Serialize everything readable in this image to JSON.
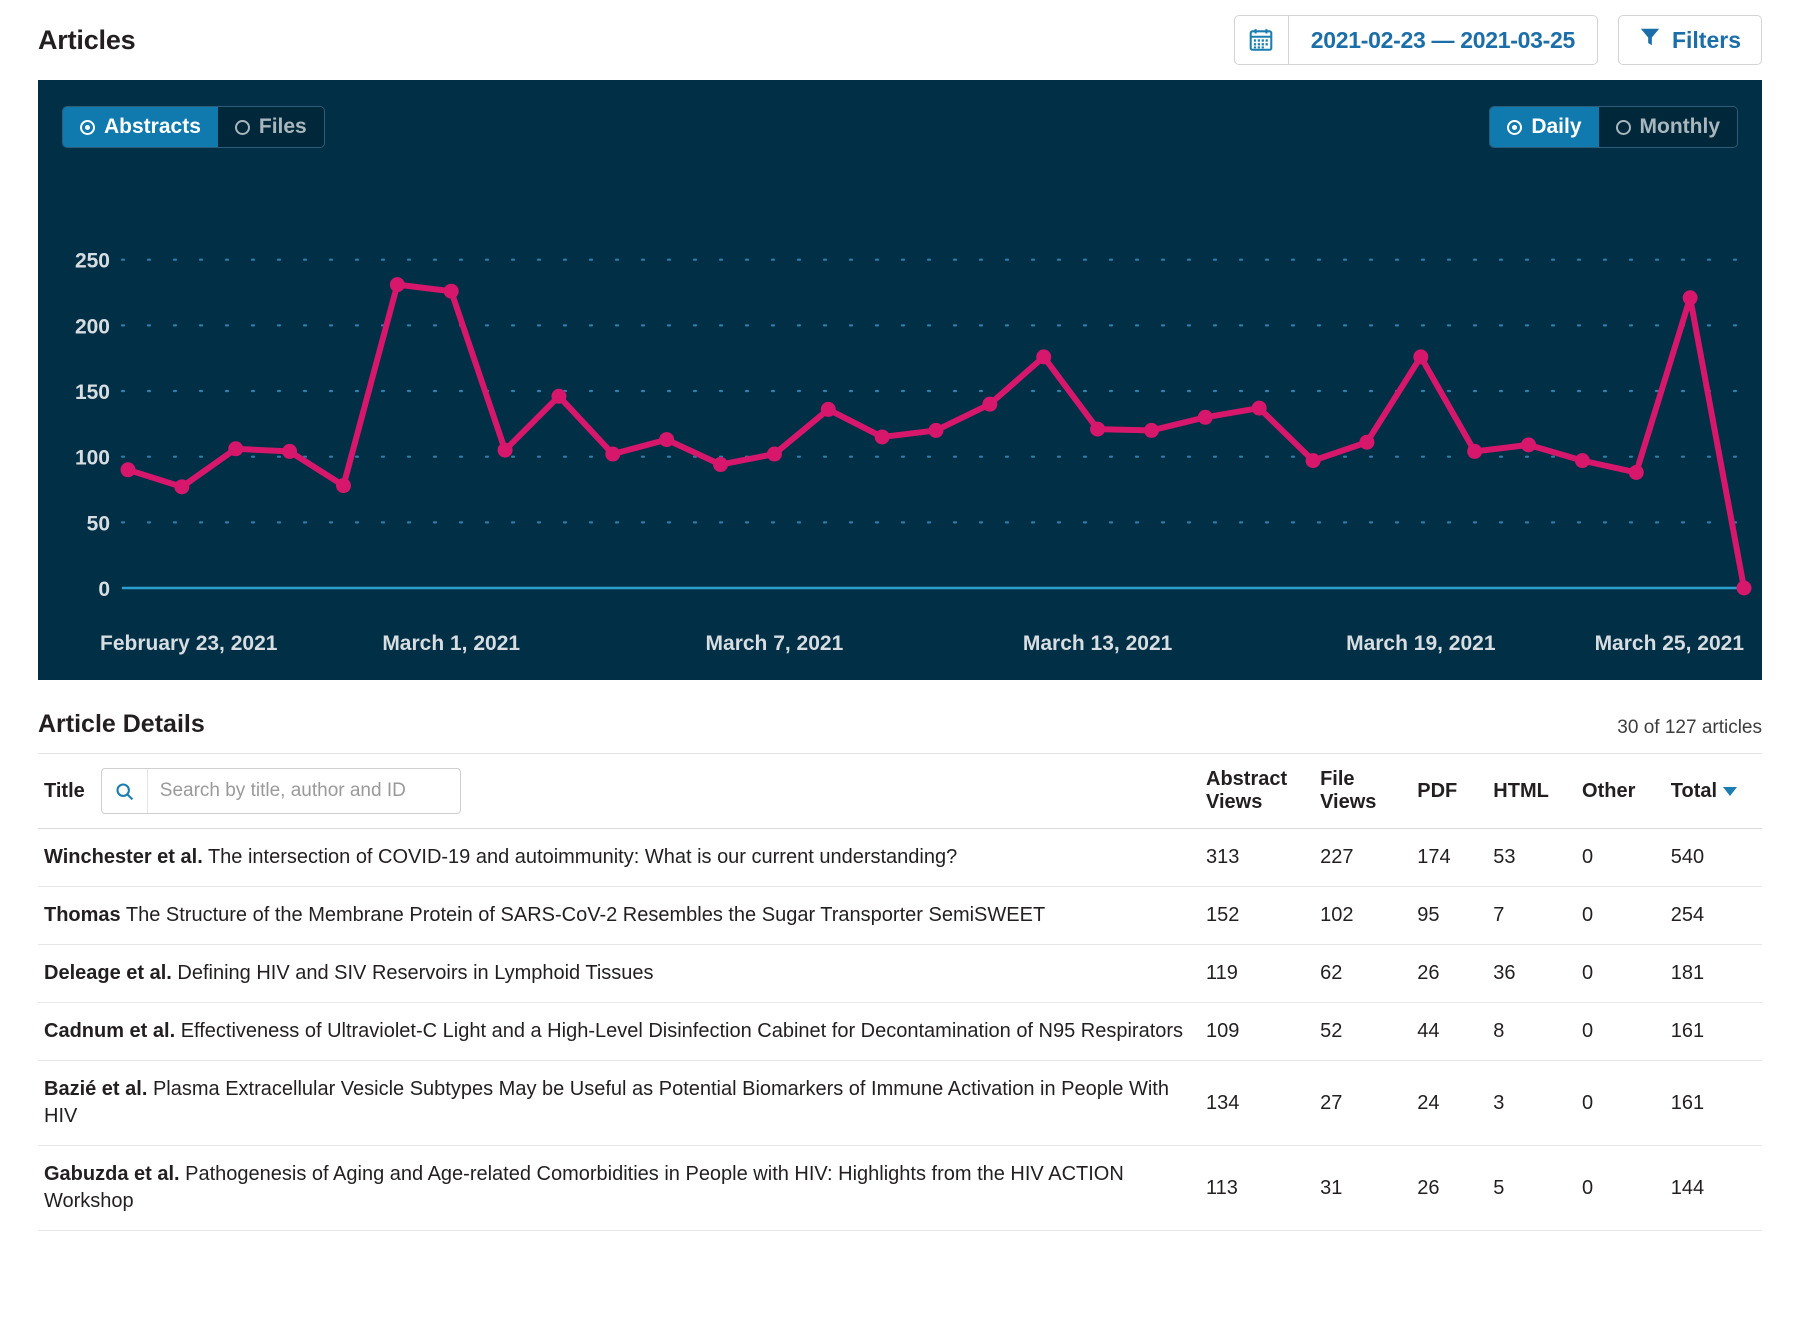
{
  "header": {
    "title": "Articles",
    "date_range": "2021-02-23 — 2021-03-25",
    "filters_label": "Filters",
    "calendar_icon": "calendar-icon",
    "filter_icon": "funnel-icon"
  },
  "chart_toggles": {
    "left": [
      {
        "label": "Abstracts",
        "active": true
      },
      {
        "label": "Files",
        "active": false
      }
    ],
    "right": [
      {
        "label": "Daily",
        "active": true
      },
      {
        "label": "Monthly",
        "active": false
      }
    ]
  },
  "colors": {
    "chart_background": "#002f46",
    "line": "#d6176b",
    "accent": "#1b6ea8",
    "toggle_active": "#1079ae",
    "grid_dot": "#2f7fa8",
    "axis_line": "#2a9fd0"
  },
  "chart_data": {
    "type": "line",
    "title": "",
    "xlabel": "",
    "ylabel": "",
    "ylim": [
      0,
      265
    ],
    "yticks": [
      0,
      50,
      100,
      150,
      200,
      250
    ],
    "grid": true,
    "legend": "none",
    "series_name": "Abstract views",
    "x": [
      "February 23, 2021",
      "February 24, 2021",
      "February 25, 2021",
      "February 26, 2021",
      "February 27, 2021",
      "February 28, 2021",
      "March 1, 2021",
      "March 2, 2021",
      "March 3, 2021",
      "March 4, 2021",
      "March 5, 2021",
      "March 6, 2021",
      "March 7, 2021",
      "March 8, 2021",
      "March 9, 2021",
      "March 10, 2021",
      "March 11, 2021",
      "March 12, 2021",
      "March 13, 2021",
      "March 14, 2021",
      "March 15, 2021",
      "March 16, 2021",
      "March 17, 2021",
      "March 18, 2021",
      "March 19, 2021",
      "March 20, 2021",
      "March 21, 2021",
      "March 22, 2021",
      "March 23, 2021",
      "March 24, 2021",
      "March 25, 2021"
    ],
    "values": [
      90,
      77,
      106,
      104,
      78,
      231,
      226,
      105,
      146,
      102,
      113,
      94,
      102,
      136,
      115,
      120,
      140,
      176,
      121,
      120,
      130,
      137,
      97,
      111,
      176,
      104,
      109,
      97,
      88,
      221,
      0
    ],
    "xtick_labels": [
      "February 23, 2021",
      "March  1, 2021",
      "March  7, 2021",
      "March 13, 2021",
      "March 19, 2021",
      "March 25, 2021"
    ],
    "xtick_indices": [
      0,
      6,
      12,
      18,
      24,
      30
    ]
  },
  "details": {
    "title": "Article Details",
    "count_text": "30 of 127 articles",
    "search": {
      "label": "Title",
      "placeholder": "Search by title, author and ID",
      "value": "",
      "icon": "search-icon"
    },
    "columns": [
      "Abstract Views",
      "File Views",
      "PDF",
      "HTML",
      "Other",
      "Total"
    ],
    "sorted_column": "Total",
    "sort_direction": "desc",
    "rows": [
      {
        "author": "Winchester et al.",
        "title": "The intersection of COVID-19 and autoimmunity: What is our current understanding?",
        "abstract_views": "313",
        "file_views": "227",
        "pdf": "174",
        "html": "53",
        "other": "0",
        "total": "540"
      },
      {
        "author": "Thomas",
        "title": "The Structure of the Membrane Protein of SARS-CoV-2 Resembles the Sugar Transporter SemiSWEET",
        "abstract_views": "152",
        "file_views": "102",
        "pdf": "95",
        "html": "7",
        "other": "0",
        "total": "254"
      },
      {
        "author": "Deleage et al.",
        "title": "Defining HIV and SIV Reservoirs in Lymphoid Tissues",
        "abstract_views": "119",
        "file_views": "62",
        "pdf": "26",
        "html": "36",
        "other": "0",
        "total": "181"
      },
      {
        "author": "Cadnum et al.",
        "title": "Effectiveness of Ultraviolet-C Light and a High-Level Disinfection Cabinet for Decontamination of N95 Respirators",
        "abstract_views": "109",
        "file_views": "52",
        "pdf": "44",
        "html": "8",
        "other": "0",
        "total": "161"
      },
      {
        "author": "Bazié et al.",
        "title": "Plasma Extracellular Vesicle Subtypes May be Useful as Potential Biomarkers of Immune Activation in People With HIV",
        "abstract_views": "134",
        "file_views": "27",
        "pdf": "24",
        "html": "3",
        "other": "0",
        "total": "161"
      },
      {
        "author": "Gabuzda et al.",
        "title": "Pathogenesis of Aging and Age-related Comorbidities in People with HIV: Highlights from the HIV ACTION Workshop",
        "abstract_views": "113",
        "file_views": "31",
        "pdf": "26",
        "html": "5",
        "other": "0",
        "total": "144"
      }
    ]
  }
}
